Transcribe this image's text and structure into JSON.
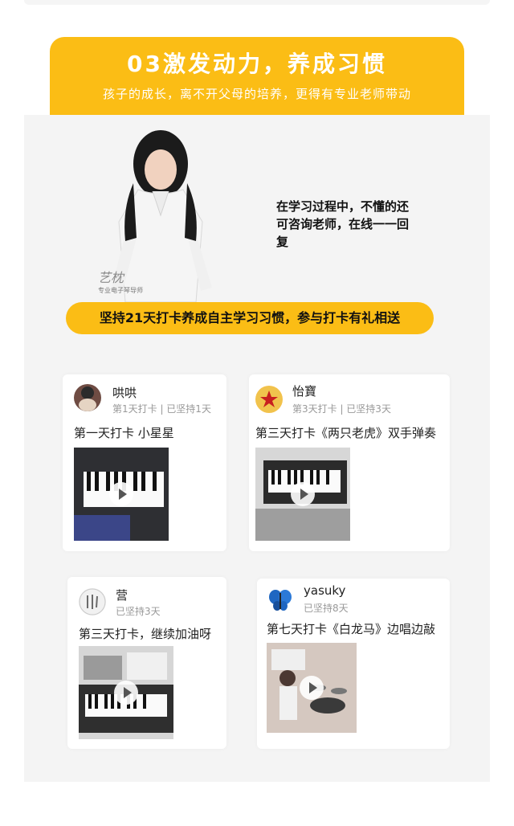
{
  "banner": {
    "title": "03激发动力，养成习惯",
    "subtitle": "孩子的成长，离不开父母的培养，更得有专业老师带动"
  },
  "teacher": {
    "signature": "艺枕",
    "tag": "专业电子琴导师",
    "speech": "在学习过程中，不懂的还可咨询老师，在线一一回复"
  },
  "pill_text": "坚持21天打卡养成自主学习习惯，参与打卡有礼相送",
  "cards": [
    {
      "name": "哄哄",
      "meta": "第1天打卡 | 已坚持1天",
      "post": "第一天打卡 小星星"
    },
    {
      "name": "怡寶",
      "meta": "第3天打卡 | 已坚持3天",
      "post": "第三天打卡《两只老虎》双手弹奏"
    },
    {
      "name": "营",
      "meta": "已坚持3天",
      "post": "第三天打卡，继续加油呀"
    },
    {
      "name": "yasuky",
      "meta": "已坚持8天",
      "post": "第七天打卡《白龙马》边唱边敲"
    }
  ],
  "icons": {
    "play": "play-icon",
    "avatar_badge": "star-badge-icon",
    "avatar_butterfly": "butterfly-icon"
  },
  "colors": {
    "accent": "#fbbd15",
    "panel": "#f4f4f4"
  }
}
